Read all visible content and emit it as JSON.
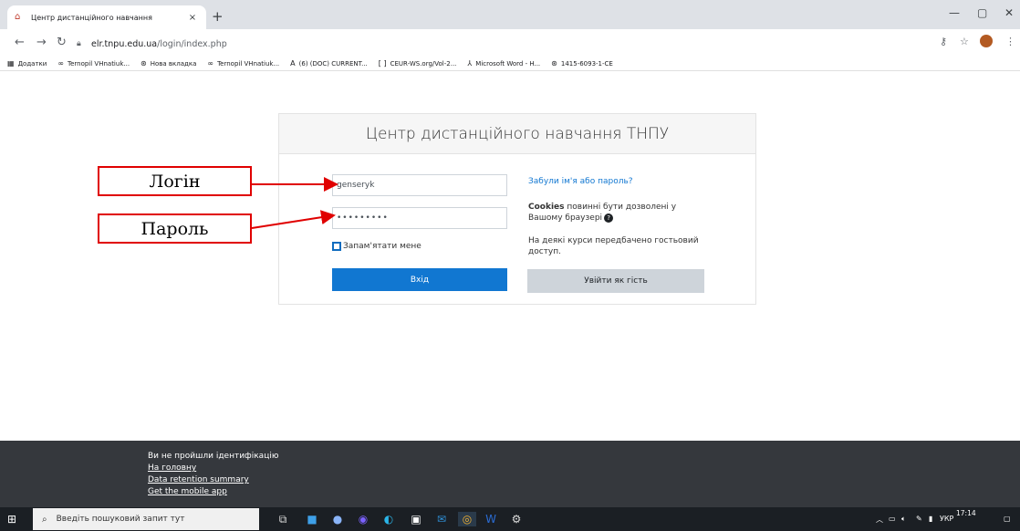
{
  "browser": {
    "tab_title": "Центр дистанційного навчання",
    "tab_close": "×",
    "new_tab": "+",
    "url_host": "elr.tnpu.edu.ua",
    "url_path": "/login/index.php",
    "bookmarks": [
      {
        "icon": "apps-icon",
        "glyph": "▦",
        "label": "Додатки"
      },
      {
        "icon": "link-icon",
        "glyph": "∞",
        "label": "Ternopil VHnatiuk..."
      },
      {
        "icon": "globe-icon",
        "glyph": "⊛",
        "label": "Нова вкладка"
      },
      {
        "icon": "link-icon",
        "glyph": "∞",
        "label": "Ternopil VHnatiuk..."
      },
      {
        "icon": "academia-icon",
        "glyph": "A",
        "label": "(6) (DOC) CURRENT..."
      },
      {
        "icon": "ceur-icon",
        "glyph": "[ ]",
        "label": "CEUR-WS.org/Vol-2..."
      },
      {
        "icon": "word-icon",
        "glyph": "⅄",
        "label": "Microsoft Word - H..."
      },
      {
        "icon": "globe-icon",
        "glyph": "⊛",
        "label": "1415-6093-1-CE"
      }
    ]
  },
  "login": {
    "header": "Центр дистанційного навчання ТНПУ",
    "username_value": "genseryk",
    "password_value": "•••••••••",
    "remember_label": "Запам'ятати мене",
    "submit_label": "Вхід",
    "forgot_link": "Забули ім'я або пароль?",
    "cookies_bold": "Cookies",
    "cookies_text": " повинні бути дозволені у Вашому браузері",
    "help_glyph": "?",
    "guest_note": "На деякі курси передбачено гостьовий доступ.",
    "guest_button": "Увійти як гість"
  },
  "annotations": {
    "login_label": "Логін",
    "password_label": "Пароль",
    "color": "#e00000"
  },
  "footer": {
    "not_logged": "Ви не пройшли ідентифікацію",
    "home": "На головну",
    "data_retention": "Data retention summary",
    "mobile_app": "Get the mobile app"
  },
  "taskbar": {
    "search_placeholder": "Введіть пошуковий запит тут",
    "language": "УКР",
    "time": "17:14"
  },
  "colors": {
    "primary": "#1177d1",
    "footer_bg": "#35383d",
    "taskbar_bg": "#1b1f24"
  }
}
